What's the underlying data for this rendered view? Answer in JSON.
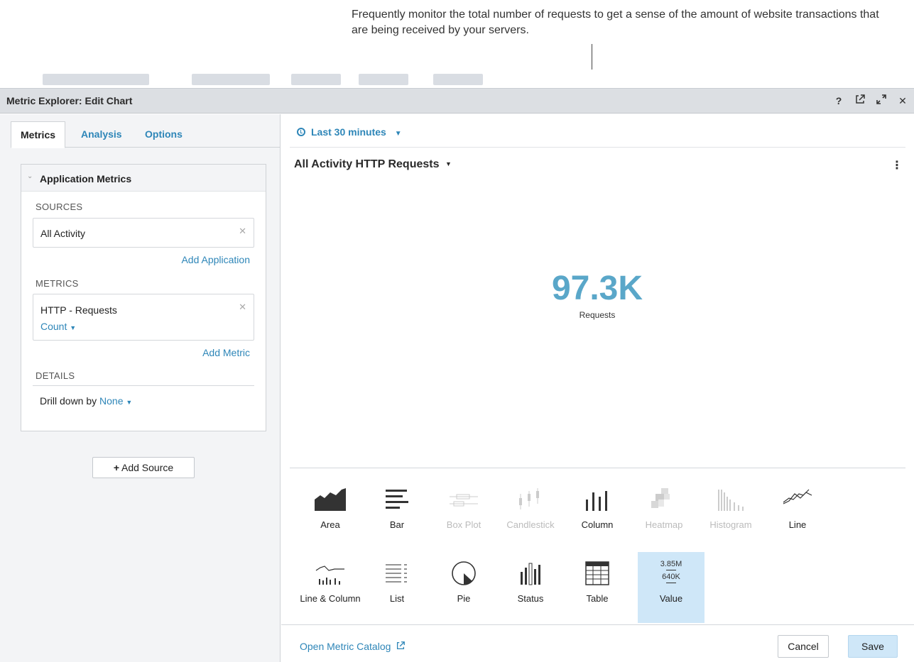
{
  "callout": {
    "text": "Frequently monitor the total number of requests to get a sense of the amount of website transactions that are being received by your servers."
  },
  "window": {
    "title": "Metric Explorer: Edit Chart",
    "icons": [
      "help-icon",
      "external-link-icon",
      "expand-icon",
      "close-icon"
    ],
    "help_glyph": "?",
    "close_glyph": "✕"
  },
  "tabs": [
    {
      "label": "Metrics",
      "active": true
    },
    {
      "label": "Analysis",
      "active": false
    },
    {
      "label": "Options",
      "active": false
    }
  ],
  "card": {
    "title": "Application Metrics",
    "sources_label": "SOURCES",
    "source_value": "All Activity",
    "add_application": "Add Application",
    "metrics_label": "METRICS",
    "metric_value": "HTTP - Requests",
    "metric_agg": "Count",
    "add_metric": "Add Metric",
    "details_label": "DETAILS",
    "drill_label": "Drill down by",
    "drill_value": "None"
  },
  "add_source": "Add Source",
  "time_range": "Last 30 minutes",
  "chart": {
    "title": "All Activity HTTP Requests",
    "value": "97.3K",
    "unit": "Requests"
  },
  "chart_types": [
    {
      "label": "Area",
      "disabled": false,
      "selected": false
    },
    {
      "label": "Bar",
      "disabled": false,
      "selected": false
    },
    {
      "label": "Box Plot",
      "disabled": true,
      "selected": false
    },
    {
      "label": "Candlestick",
      "disabled": true,
      "selected": false
    },
    {
      "label": "Column",
      "disabled": false,
      "selected": false
    },
    {
      "label": "Heatmap",
      "disabled": true,
      "selected": false
    },
    {
      "label": "Histogram",
      "disabled": true,
      "selected": false
    },
    {
      "label": "Line",
      "disabled": false,
      "selected": false
    },
    {
      "label": "Line & Column",
      "disabled": false,
      "selected": false
    },
    {
      "label": "List",
      "disabled": false,
      "selected": false
    },
    {
      "label": "Pie",
      "disabled": false,
      "selected": false
    },
    {
      "label": "Status",
      "disabled": false,
      "selected": false
    },
    {
      "label": "Table",
      "disabled": false,
      "selected": false
    },
    {
      "label": "Value",
      "disabled": false,
      "selected": true
    }
  ],
  "value_icon": {
    "top": "3.85M",
    "bottom": "640K"
  },
  "footer": {
    "catalog_link": "Open Metric Catalog",
    "cancel": "Cancel",
    "save": "Save"
  },
  "colors": {
    "accent": "#2e86b8",
    "value": "#5aa7c9",
    "selected_bg": "#cfe7f8"
  }
}
